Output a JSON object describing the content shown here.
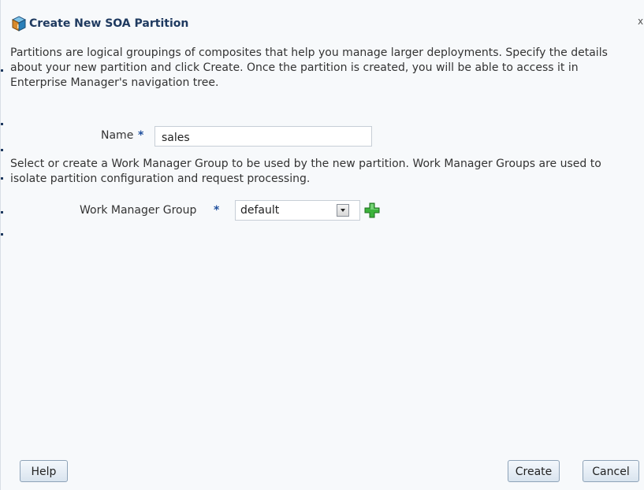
{
  "dialog": {
    "title": "Create New SOA Partition",
    "close_label": "x",
    "intro_text": "Partitions are logical groupings of composites that help you manage larger deployments. Specify the details about your new partition and click Create. Once the partition is created, you will be able to access it in Enterprise Manager's navigation tree.",
    "name_label": "Name",
    "required_marker": "*",
    "name_value": "sales",
    "wmg_intro_text": "Select or create a Work Manager Group to be used by the new partition. Work Manager Groups are used to isolate partition configuration and request processing.",
    "wmg_label": "Work Manager Group",
    "wmg_selected": "default",
    "help_label": "Help",
    "create_label": "Create",
    "cancel_label": "Cancel"
  },
  "icons": {
    "title_icon": "partition-cube-icon",
    "add_icon": "plus-icon",
    "dropdown_icon": "chevron-down-icon"
  },
  "colors": {
    "title": "#1f3a60",
    "required": "#1f4f9c",
    "add_green": "#2fa52f",
    "button_border": "#8ea3b8"
  }
}
